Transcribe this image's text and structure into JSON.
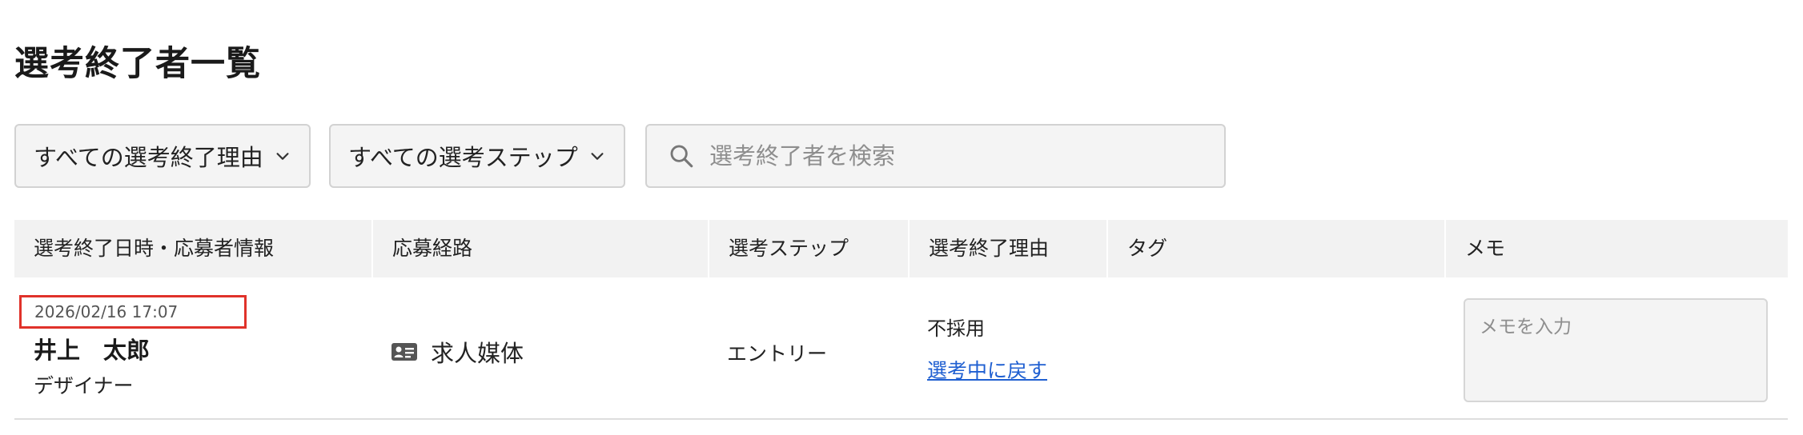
{
  "page": {
    "title": "選考終了者一覧"
  },
  "filters": {
    "reason_select": "すべての選考終了理由",
    "step_select": "すべての選考ステップ",
    "search_placeholder": "選考終了者を検索"
  },
  "table": {
    "headers": [
      "選考終了日時・応募者情報",
      "応募経路",
      "選考ステップ",
      "選考終了理由",
      "タグ",
      "メモ"
    ],
    "rows": [
      {
        "datetime": "2026/02/16 17:07",
        "name": "井上　太郎",
        "role": "デザイナー",
        "channel": "求人媒体",
        "channel_icon": "id-card-icon",
        "step": "エントリー",
        "reason": "不採用",
        "revert_label": "選考中に戻す",
        "tags": "",
        "memo_placeholder": "メモを入力"
      }
    ]
  },
  "colors": {
    "link": "#1f5fd1",
    "highlight_border": "#e0322a",
    "header_bg": "#f2f2f2"
  }
}
